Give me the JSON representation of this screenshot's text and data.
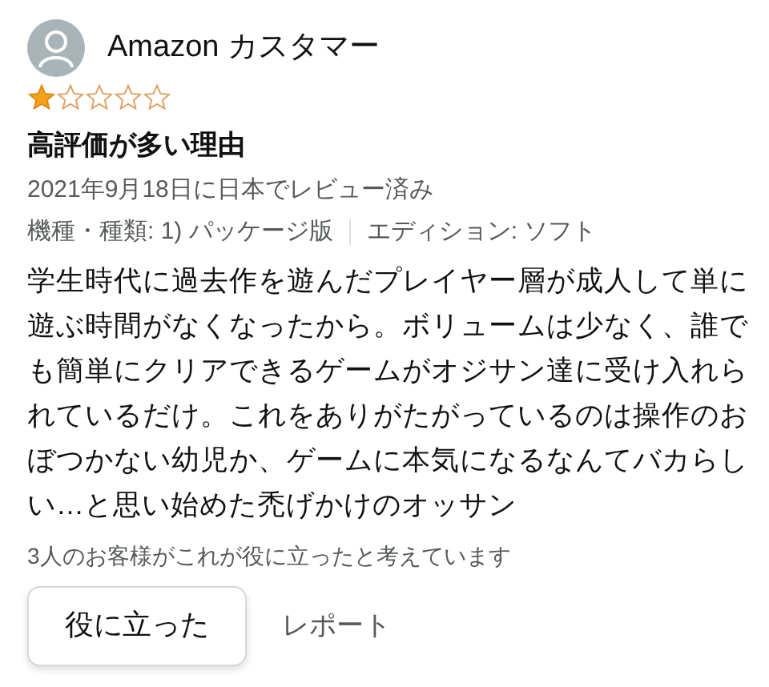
{
  "review": {
    "author": "Amazon カスタマー",
    "stars": 1,
    "title": "高評価が多い理由",
    "date": "2021年9月18日に日本でレビュー済み",
    "variants": [
      "機種・種類: 1) パッケージ版",
      "エディション: ソフト"
    ],
    "body": "学生時代に過去作を遊んだプレイヤー層が成人して単に遊ぶ時間がなくなったから。ボリュームは少なく、誰でも簡単にクリアできるゲームがオジサン達に受け入れられているだけ。これをありがたがっているのは操作のおぼつかない幼児か、ゲームに本気になるなんてバカらしい…と思い始めた禿げかけのオッサン",
    "helpful_count": "3人のお客様がこれが役に立ったと考えています",
    "buttons": [
      "役に立った",
      "レポート"
    ]
  }
}
